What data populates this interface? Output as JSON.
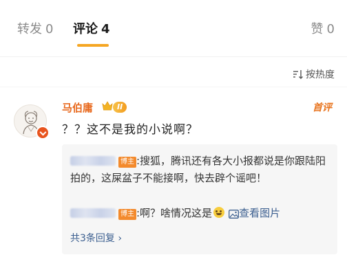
{
  "tabs": {
    "repost": {
      "label": "转发",
      "count": "0"
    },
    "comment": {
      "label": "评论",
      "count": "4"
    },
    "like": {
      "label": "赞",
      "count": "0"
    }
  },
  "sort": {
    "label": "按热度"
  },
  "comment": {
    "username": "马伯庸",
    "level": "II",
    "tag": "首评",
    "text": "？？这不是我的小说啊？"
  },
  "replies": [
    {
      "author_tag": "博主",
      "text": ":搜狐，腾讯还有各大小报都说是你跟陆阳拍的，这屎盆子不能接啊，快去辟个谣吧！"
    },
    {
      "author_tag": "博主",
      "text": ":啊？啥情况这是",
      "link": "查看图片"
    }
  ],
  "reply_count": "共3条回复 ›",
  "colors": {
    "accent": "#f5a623",
    "username": "#e86a1f",
    "author_tag": "#f38a2d",
    "link": "#3b5e8f"
  }
}
